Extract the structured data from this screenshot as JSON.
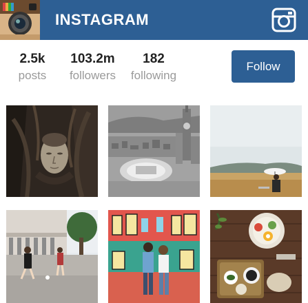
{
  "header": {
    "title": "INSTAGRAM",
    "avatar_icon": "instagram-camera-logo",
    "camera_icon": "camera-icon",
    "colors": {
      "bar": "#2d5f94",
      "text": "#ffffff"
    }
  },
  "profile": {
    "stats": [
      {
        "value": "2.5k",
        "label": "posts"
      },
      {
        "value": "103.2m",
        "label": "followers"
      },
      {
        "value": "182",
        "label": "following"
      }
    ],
    "follow_label": "Follow"
  },
  "grid": {
    "photos": [
      {
        "subject": "buddha-head-in-tree-roots"
      },
      {
        "subject": "city-aerial-clock-tower"
      },
      {
        "subject": "person-with-umbrella-in-field"
      },
      {
        "subject": "kids-playing-football-plaza"
      },
      {
        "subject": "couple-by-colorful-mural"
      },
      {
        "subject": "food-bowls-on-wooden-table"
      }
    ]
  }
}
